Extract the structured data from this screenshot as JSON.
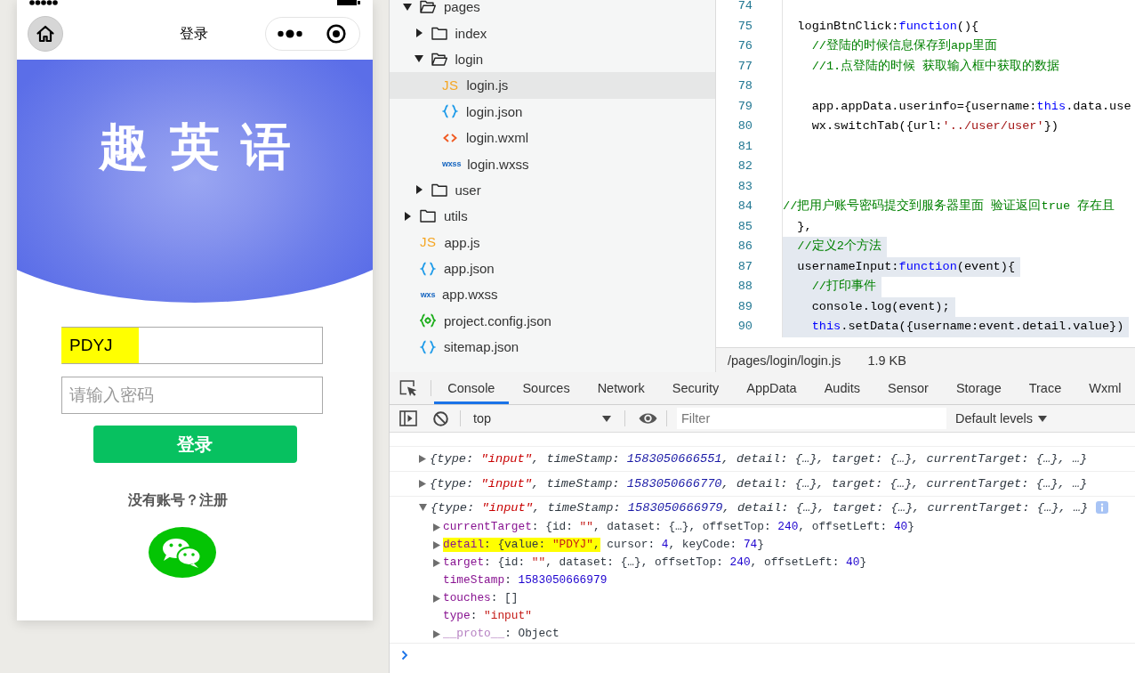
{
  "simulator": {
    "nav": {
      "title": "登录"
    },
    "banner": {
      "title": "趣英语"
    },
    "fields": [
      {
        "kind": "username",
        "value": "PDYJ",
        "highlighted": true
      },
      {
        "kind": "password",
        "placeholder": "请输入密码",
        "highlighted": false
      }
    ],
    "login_button": "登录",
    "register_link": "没有账号？注册"
  },
  "file_tree": {
    "items": [
      {
        "name": "pages",
        "kind": "folder",
        "expanded": true,
        "selected": false,
        "children": [
          {
            "name": "index",
            "kind": "folder",
            "expanded": false,
            "selected": false
          },
          {
            "name": "login",
            "kind": "folder",
            "expanded": true,
            "selected": false,
            "children": [
              {
                "name": "login.js",
                "kind": "js",
                "icon_text": "JS",
                "selected": true
              },
              {
                "name": "login.json",
                "kind": "json",
                "selected": false
              },
              {
                "name": "login.wxml",
                "kind": "wxml",
                "selected": false
              },
              {
                "name": "login.wxss",
                "kind": "wxss",
                "icon_text": "wxss",
                "selected": false
              }
            ]
          },
          {
            "name": "user",
            "kind": "folder",
            "expanded": false,
            "selected": false
          }
        ]
      },
      {
        "name": "utils",
        "kind": "folder",
        "expanded": false,
        "selected": false
      },
      {
        "name": "app.js",
        "kind": "js",
        "icon_text": "JS",
        "selected": false
      },
      {
        "name": "app.json",
        "kind": "json",
        "selected": false
      },
      {
        "name": "app.wxss",
        "kind": "wxss",
        "icon_text": "wxs",
        "selected": false
      },
      {
        "name": "project.config.json",
        "kind": "config",
        "selected": false
      },
      {
        "name": "sitemap.json",
        "kind": "json",
        "selected": false
      }
    ]
  },
  "editor": {
    "lines": [
      {
        "number": "74",
        "selected": false
      },
      {
        "number": "75",
        "selected": false,
        "tokens": [
          {
            "text": "  loginBtnClick:",
            "kind": "plain"
          },
          {
            "text": "function",
            "kind": "keyword"
          },
          {
            "text": "(){",
            "kind": "plain"
          }
        ]
      },
      {
        "number": "76",
        "selected": false,
        "tokens": [
          {
            "text": "    //登陆的时候信息保存到app里面",
            "kind": "comment"
          }
        ]
      },
      {
        "number": "77",
        "selected": false,
        "tokens": [
          {
            "text": "    //1.点登陆的时候 获取输入框中获取的数据",
            "kind": "comment"
          }
        ]
      },
      {
        "number": "78",
        "selected": false
      },
      {
        "number": "79",
        "selected": false,
        "tokens": [
          {
            "text": "    app.appData.userinfo={username:",
            "kind": "plain"
          },
          {
            "text": "this",
            "kind": "keyword"
          },
          {
            "text": ".data.use",
            "kind": "plain"
          }
        ]
      },
      {
        "number": "80",
        "selected": false,
        "tokens": [
          {
            "text": "    wx.switchTab({url:",
            "kind": "plain"
          },
          {
            "text": "'../user/user'",
            "kind": "string"
          },
          {
            "text": "})",
            "kind": "plain"
          }
        ]
      },
      {
        "number": "81",
        "selected": false
      },
      {
        "number": "82",
        "selected": false
      },
      {
        "number": "83",
        "selected": false
      },
      {
        "number": "84",
        "selected": false,
        "tokens": [
          {
            "text": "//把用户账号密码提交到服务器里面 验证返回true 存在且",
            "kind": "comment"
          }
        ]
      },
      {
        "number": "85",
        "selected": false,
        "tokens": [
          {
            "text": "  },",
            "kind": "plain"
          }
        ]
      },
      {
        "number": "86",
        "selected": true,
        "tokens": [
          {
            "text": "  //定义2个方法",
            "kind": "comment"
          }
        ]
      },
      {
        "number": "87",
        "selected": true,
        "tokens": [
          {
            "text": "  usernameInput:",
            "kind": "plain"
          },
          {
            "text": "function",
            "kind": "keyword"
          },
          {
            "text": "(event){",
            "kind": "plain"
          }
        ]
      },
      {
        "number": "88",
        "selected": true,
        "tokens": [
          {
            "text": "    //打印事件",
            "kind": "comment"
          }
        ]
      },
      {
        "number": "89",
        "selected": true,
        "tokens": [
          {
            "text": "    console.log(event);",
            "kind": "plain"
          }
        ]
      },
      {
        "number": "90",
        "selected": true,
        "tokens": [
          {
            "text": "    this",
            "kind": "keyword"
          },
          {
            "text": ".setData({username:event.detail.value})",
            "kind": "plain"
          }
        ]
      }
    ],
    "status": {
      "path": "/pages/login/login.js",
      "size": "1.9 KB"
    }
  },
  "console": {
    "tabs": [
      {
        "label": "Console",
        "selected": true
      },
      {
        "label": "Sources",
        "selected": false
      },
      {
        "label": "Network",
        "selected": false
      },
      {
        "label": "Security",
        "selected": false
      },
      {
        "label": "AppData",
        "selected": false
      },
      {
        "label": "Audits",
        "selected": false
      },
      {
        "label": "Sensor",
        "selected": false
      },
      {
        "label": "Storage",
        "selected": false
      },
      {
        "label": "Trace",
        "selected": false
      },
      {
        "label": "Wxml",
        "selected": false
      }
    ],
    "toolbar": {
      "context": "top",
      "filter": {
        "placeholder": "Filter"
      },
      "levels": "Default levels"
    },
    "messages": [
      {
        "expanded": false,
        "info_badge": false,
        "segments": [
          {
            "text": "{type: ",
            "kind": "plain"
          },
          {
            "text": "\"input\"",
            "kind": "string"
          },
          {
            "text": ", timeStamp: ",
            "kind": "plain"
          },
          {
            "text": "1583050666551",
            "kind": "number"
          },
          {
            "text": ", detail: {…}, target: {…}, currentTarget: {…}, …}",
            "kind": "plain"
          }
        ]
      },
      {
        "expanded": false,
        "info_badge": false,
        "segments": [
          {
            "text": "{type: ",
            "kind": "plain"
          },
          {
            "text": "\"input\"",
            "kind": "string"
          },
          {
            "text": ", timeStamp: ",
            "kind": "plain"
          },
          {
            "text": "1583050666770",
            "kind": "number"
          },
          {
            "text": ", detail: {…}, target: {…}, currentTarget: {…}, …}",
            "kind": "plain"
          }
        ]
      },
      {
        "expanded": true,
        "info_badge": true,
        "segments": [
          {
            "text": "{type: ",
            "kind": "plain"
          },
          {
            "text": "\"input\"",
            "kind": "string"
          },
          {
            "text": ", timeStamp: ",
            "kind": "plain"
          },
          {
            "text": "1583050666979",
            "kind": "number"
          },
          {
            "text": ", detail: {…}, target: {…}, currentTarget: {…}, …}",
            "kind": "plain"
          }
        ],
        "children": [
          {
            "key": "currentTarget",
            "kind": "own",
            "expandable": true,
            "highlighted": false,
            "value": [
              {
                "highlighted": false,
                "segments": [
                  {
                    "text": ": {id: ",
                    "kind": "plain"
                  },
                  {
                    "text": "\"\"",
                    "kind": "string"
                  },
                  {
                    "text": ", dataset: {…}, offsetTop: ",
                    "kind": "plain"
                  },
                  {
                    "text": "240",
                    "kind": "number"
                  },
                  {
                    "text": ", offsetLeft: ",
                    "kind": "plain"
                  },
                  {
                    "text": "40",
                    "kind": "number"
                  },
                  {
                    "text": "}",
                    "kind": "plain"
                  }
                ]
              }
            ]
          },
          {
            "key": "detail",
            "kind": "own",
            "expandable": true,
            "highlighted": true,
            "value": [
              {
                "highlighted": true,
                "segments": [
                  {
                    "text": ": {value: ",
                    "kind": "plain"
                  },
                  {
                    "text": "\"PDYJ\"",
                    "kind": "string"
                  },
                  {
                    "text": ",",
                    "kind": "plain"
                  }
                ]
              },
              {
                "highlighted": false,
                "segments": [
                  {
                    "text": " cursor: ",
                    "kind": "plain"
                  },
                  {
                    "text": "4",
                    "kind": "number"
                  },
                  {
                    "text": ", keyCode: ",
                    "kind": "plain"
                  },
                  {
                    "text": "74",
                    "kind": "number"
                  },
                  {
                    "text": "}",
                    "kind": "plain"
                  }
                ]
              }
            ]
          },
          {
            "key": "target",
            "kind": "own",
            "expandable": true,
            "highlighted": false,
            "value": [
              {
                "highlighted": false,
                "segments": [
                  {
                    "text": ": {id: ",
                    "kind": "plain"
                  },
                  {
                    "text": "\"\"",
                    "kind": "string"
                  },
                  {
                    "text": ", dataset: {…}, offsetTop: ",
                    "kind": "plain"
                  },
                  {
                    "text": "240",
                    "kind": "number"
                  },
                  {
                    "text": ", offsetLeft: ",
                    "kind": "plain"
                  },
                  {
                    "text": "40",
                    "kind": "number"
                  },
                  {
                    "text": "}",
                    "kind": "plain"
                  }
                ]
              }
            ]
          },
          {
            "key": "timeStamp",
            "kind": "own",
            "expandable": false,
            "highlighted": false,
            "value": [
              {
                "highlighted": false,
                "segments": [
                  {
                    "text": ": ",
                    "kind": "plain"
                  },
                  {
                    "text": "1583050666979",
                    "kind": "number"
                  }
                ]
              }
            ]
          },
          {
            "key": "touches",
            "kind": "own",
            "expandable": true,
            "highlighted": false,
            "value": [
              {
                "highlighted": false,
                "segments": [
                  {
                    "text": ": []",
                    "kind": "plain"
                  }
                ]
              }
            ]
          },
          {
            "key": "type",
            "kind": "own",
            "expandable": false,
            "highlighted": false,
            "value": [
              {
                "highlighted": false,
                "segments": [
                  {
                    "text": ": ",
                    "kind": "plain"
                  },
                  {
                    "text": "\"input\"",
                    "kind": "string"
                  }
                ]
              }
            ]
          },
          {
            "key": "__proto__",
            "kind": "internal",
            "expandable": true,
            "highlighted": false,
            "value": [
              {
                "highlighted": false,
                "segments": [
                  {
                    "text": ": Object",
                    "kind": "plain"
                  }
                ]
              }
            ]
          }
        ]
      }
    ]
  }
}
